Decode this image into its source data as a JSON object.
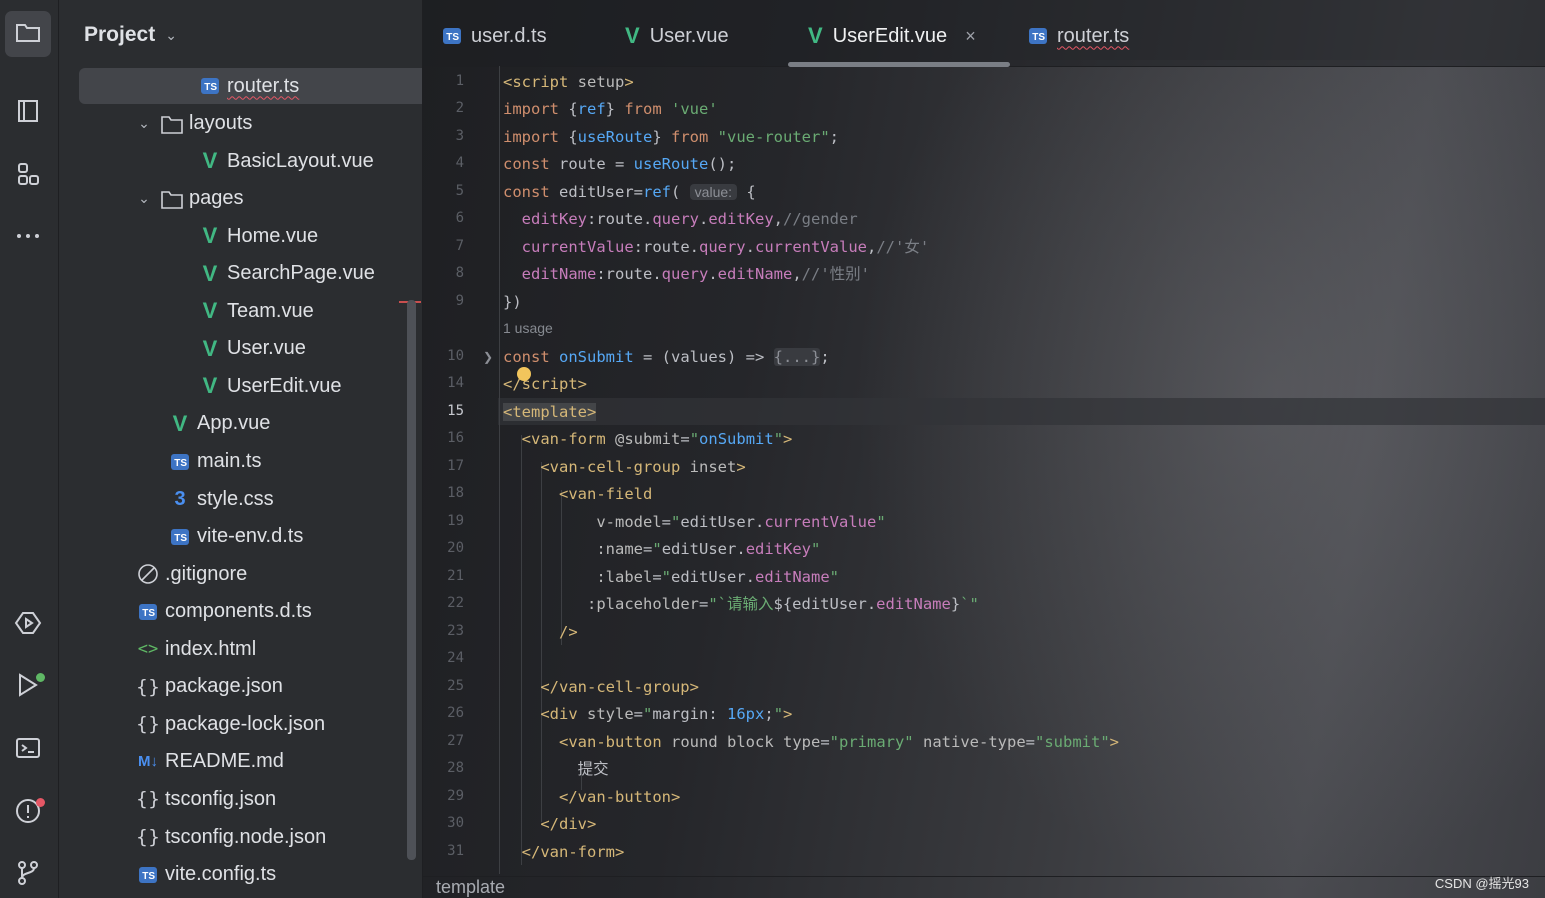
{
  "activity_bar": {
    "items": [
      {
        "name": "project-tool",
        "icon": "folder-icon",
        "active": true
      },
      {
        "name": "structure-tool",
        "icon": "bookmarks-icon"
      },
      {
        "name": "plugins-tool",
        "icon": "plugins-icon"
      },
      {
        "name": "more-tools",
        "icon": "more-icon"
      },
      {
        "name": "services-tool",
        "icon": "services-icon"
      },
      {
        "name": "run-tool",
        "icon": "run-icon"
      },
      {
        "name": "terminal-tool",
        "icon": "terminal-icon"
      },
      {
        "name": "problems-tool",
        "icon": "problems-icon"
      },
      {
        "name": "git-tool",
        "icon": "git-icon"
      }
    ]
  },
  "project": {
    "title": "Project",
    "tree": [
      {
        "label": "router.ts",
        "type": "ts",
        "indent": 3,
        "selected": true,
        "error": true
      },
      {
        "label": "layouts",
        "type": "folder",
        "indent": 2
      },
      {
        "label": "BasicLayout.vue",
        "type": "vue",
        "indent": 3
      },
      {
        "label": "pages",
        "type": "folder",
        "indent": 2
      },
      {
        "label": "Home.vue",
        "type": "vue",
        "indent": 3
      },
      {
        "label": "SearchPage.vue",
        "type": "vue",
        "indent": 3
      },
      {
        "label": "Team.vue",
        "type": "vue",
        "indent": 3
      },
      {
        "label": "User.vue",
        "type": "vue",
        "indent": 3
      },
      {
        "label": "UserEdit.vue",
        "type": "vue",
        "indent": 3
      },
      {
        "label": "App.vue",
        "type": "vue",
        "indent": 2
      },
      {
        "label": "main.ts",
        "type": "ts",
        "indent": 2
      },
      {
        "label": "style.css",
        "type": "css",
        "indent": 2
      },
      {
        "label": "vite-env.d.ts",
        "type": "ts",
        "indent": 2
      },
      {
        "label": ".gitignore",
        "type": "ignore",
        "indent": 1
      },
      {
        "label": "components.d.ts",
        "type": "ts",
        "indent": 1
      },
      {
        "label": "index.html",
        "type": "html",
        "indent": 1
      },
      {
        "label": "package.json",
        "type": "json",
        "indent": 1
      },
      {
        "label": "package-lock.json",
        "type": "json",
        "indent": 1
      },
      {
        "label": "README.md",
        "type": "md",
        "indent": 1
      },
      {
        "label": "tsconfig.json",
        "type": "json",
        "indent": 1
      },
      {
        "label": "tsconfig.node.json",
        "type": "json",
        "indent": 1
      },
      {
        "label": "vite.config.ts",
        "type": "ts",
        "indent": 1
      }
    ]
  },
  "tabs": [
    {
      "label": "user.d.ts",
      "type": "ts"
    },
    {
      "label": "User.vue",
      "type": "vue"
    },
    {
      "label": "UserEdit.vue",
      "type": "vue",
      "active": true,
      "close": "×"
    },
    {
      "label": "router.ts",
      "type": "ts",
      "error": true
    }
  ],
  "editor": {
    "usage_hint": "1 usage",
    "param_hint": "value:",
    "fold_placeholder": "{...}",
    "lines": [
      {
        "n": "1",
        "html": "<span class='tag'>&lt;script</span> <span class='attr'>setup</span><span class='tag'>&gt;</span>"
      },
      {
        "n": "2",
        "html": "<span class='kw'>import</span> {<span class='fn'>ref</span>} <span class='kw'>from</span> <span class='str'>'vue'</span>"
      },
      {
        "n": "3",
        "html": "<span class='kw'>import</span> {<span class='fn'>useRoute</span>} <span class='kw'>from</span> <span class='str'>\"vue-router\"</span>;"
      },
      {
        "n": "4",
        "html": "<span class='kw'>const</span> route = <span class='fn'>useRoute</span>();"
      },
      {
        "n": "5",
        "html": "<span class='kw'>const</span> editUser=<span class='fn'>ref</span>( <span class='hint'>value:</span> {"
      },
      {
        "n": "6",
        "html": "  <span class='prop'>editKey</span>:route.<span class='prop'>query</span>.<span class='prop'>editKey</span>,<span class='cm'>//gender</span>"
      },
      {
        "n": "7",
        "html": "  <span class='prop'>currentValue</span>:route.<span class='prop'>query</span>.<span class='prop'>currentValue</span>,<span class='cm'>//'女'</span>"
      },
      {
        "n": "8",
        "html": "  <span class='prop'>editName</span>:route.<span class='prop'>query</span>.<span class='prop'>editName</span>,<span class='cm'>//'性别'</span>"
      },
      {
        "n": "9",
        "html": "})"
      },
      {
        "n": "10",
        "html": "<span class='kw'>const</span> <span class='fn'>onSubmit</span> = (values) =&gt; <span class='fold'>{...}</span>;"
      },
      {
        "n": "14",
        "html": "<span class='tag'>&lt;/script&gt;</span>"
      },
      {
        "n": "15",
        "html": "<span class='tag tmpl-hl'>&lt;template&gt;</span>"
      },
      {
        "n": "16",
        "html": "  <span class='tag'>&lt;van-form</span> <span class='attr'>@submit</span>=<span class='str'>\"</span><span class='fn'>onSubmit</span><span class='str'>\"</span><span class='tag'>&gt;</span>"
      },
      {
        "n": "17",
        "html": "    <span class='tag'>&lt;van-cell-group</span> <span class='attr'>inset</span><span class='tag'>&gt;</span>"
      },
      {
        "n": "18",
        "html": "      <span class='tag'>&lt;van-field</span>"
      },
      {
        "n": "19",
        "html": "          <span class='attr'>v-model</span>=<span class='str'>\"</span>editUser.<span class='prop'>currentValue</span><span class='str'>\"</span>"
      },
      {
        "n": "20",
        "html": "          <span class='attr'>:name</span>=<span class='str'>\"</span>editUser.<span class='prop'>editKey</span><span class='str'>\"</span>"
      },
      {
        "n": "21",
        "html": "          <span class='attr'>:label</span>=<span class='str'>\"</span>editUser.<span class='prop'>editName</span><span class='str'>\"</span>"
      },
      {
        "n": "22",
        "html": "         <span class='attr'>:placeholder</span>=<span class='str'>\"`请输入</span>${editUser.<span class='prop'>editName</span>}<span class='str'>`\"</span>"
      },
      {
        "n": "23",
        "html": "      <span class='tag'>/&gt;</span>"
      },
      {
        "n": "24",
        "html": ""
      },
      {
        "n": "25",
        "html": "    <span class='tag'>&lt;/van-cell-group&gt;</span>"
      },
      {
        "n": "26",
        "html": "    <span class='tag'>&lt;div</span> <span class='attr'>style</span>=<span class='str'>\"</span>margin: <span class='fn'>16px</span>;<span class='str'>\"</span><span class='tag'>&gt;</span>"
      },
      {
        "n": "27",
        "html": "      <span class='tag'>&lt;van-button</span> <span class='attr'>round block type</span>=<span class='str'>\"primary\"</span> <span class='attr'>native-type</span>=<span class='str'>\"submit\"</span><span class='tag'>&gt;</span>"
      },
      {
        "n": "28",
        "html": "        提交"
      },
      {
        "n": "29",
        "html": "      <span class='tag'>&lt;/van-button&gt;</span>"
      },
      {
        "n": "30",
        "html": "    <span class='tag'>&lt;/div&gt;</span>"
      },
      {
        "n": "31",
        "html": "  <span class='tag'>&lt;/van-form&gt;</span>"
      }
    ]
  },
  "breadcrumb": "template",
  "watermark": "CSDN @摇光93"
}
